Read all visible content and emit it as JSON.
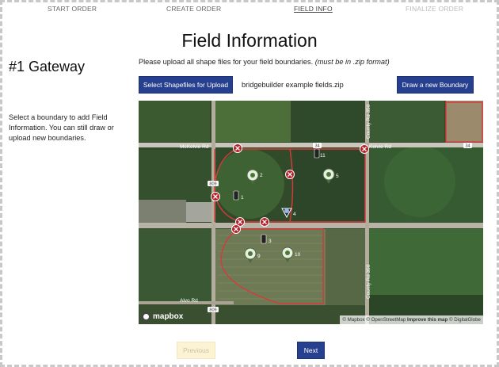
{
  "steps": [
    "START ORDER",
    "CREATE ORDER",
    "FIELD INFO",
    "FINALIZE ORDER"
  ],
  "page_title": "Field Information",
  "gateway_title": "#1 Gateway",
  "side_help": "Select a boundary to add Field Information. You can still draw or upload new boundaries.",
  "instructions": {
    "text": "Please upload all shape files for your field boundaries.",
    "note": "(must be in .zip format)"
  },
  "buttons": {
    "upload": "Select Shapefiles for Upload",
    "draw": "Draw a new Boundary",
    "previous": "Previous",
    "next": "Next"
  },
  "file_name": "bridgebuilder example fields.zip",
  "map": {
    "roads": {
      "mckelvie_left": "McKelvie Rd",
      "kelvie_right": "Kelvie Rd",
      "county_rd": "County Rd 350",
      "alvo_rd": "Alvo Rd",
      "shield_34": "34",
      "shield_809": "809"
    },
    "markers": [
      "1",
      "2",
      "3",
      "4",
      "5",
      "9",
      "10",
      "11"
    ],
    "logo": "mapbox",
    "attribution": {
      "part1": "© Mapbox © OpenStreetMap",
      "improve": "Improve this map",
      "part2": "© DigitalGlobe"
    }
  },
  "colors": {
    "primary": "#26408f",
    "boundary": "#d63a3a",
    "disabled_button": "#fbf3d3"
  }
}
